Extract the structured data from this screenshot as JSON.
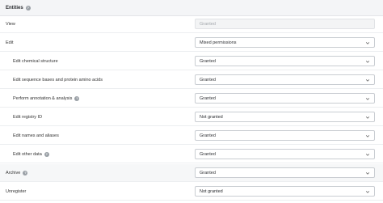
{
  "section": {
    "title": "Entities",
    "help_icon": "question-circle-icon"
  },
  "rows": [
    {
      "label": "View",
      "value": "Granted",
      "indent": 0,
      "disabled": true,
      "help": false
    },
    {
      "label": "Edit",
      "value": "Mixed permissions",
      "indent": 0,
      "disabled": false,
      "help": false
    },
    {
      "label": "Edit chemical structure",
      "value": "Granted",
      "indent": 1,
      "disabled": false,
      "help": false
    },
    {
      "label": "Edit sequence bases and protein amino acids",
      "value": "Granted",
      "indent": 1,
      "disabled": false,
      "help": false
    },
    {
      "label": "Perform annotation & analysis",
      "value": "Granted",
      "indent": 1,
      "disabled": false,
      "help": true
    },
    {
      "label": "Edit registry ID",
      "value": "Not granted",
      "indent": 1,
      "disabled": false,
      "help": false
    },
    {
      "label": "Edit names and aliases",
      "value": "Granted",
      "indent": 1,
      "disabled": false,
      "help": false
    },
    {
      "label": "Edit other data",
      "value": "Granted",
      "indent": 1,
      "disabled": false,
      "help": true
    },
    {
      "label": "Archive",
      "value": "Granted",
      "indent": 0,
      "disabled": false,
      "help": true
    },
    {
      "label": "Unregister",
      "value": "Not granted",
      "indent": 0,
      "disabled": false,
      "help": false
    }
  ],
  "colors": {
    "header_bg": "#f4f5f7",
    "border": "#c9cdd2",
    "help_icon": "#9aa0a6",
    "disabled_text": "#a2a6ab"
  }
}
